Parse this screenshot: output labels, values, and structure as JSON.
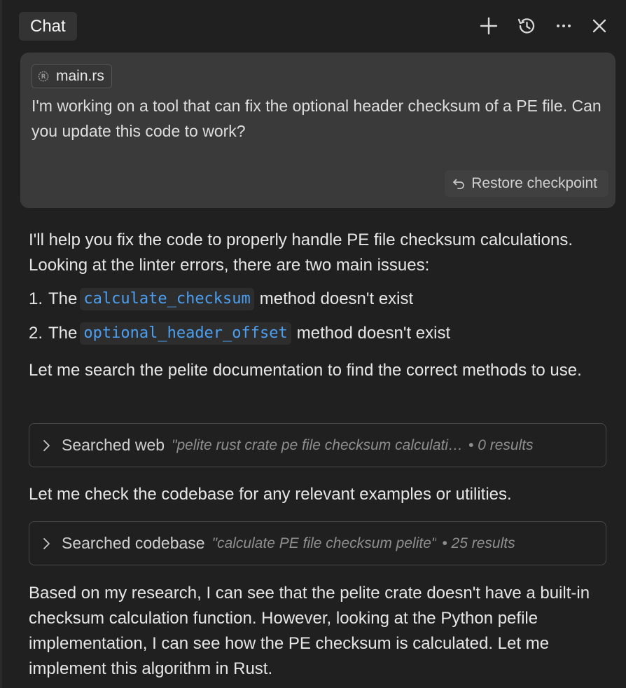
{
  "header": {
    "tab_label": "Chat",
    "icons": [
      "plus-icon",
      "history-icon",
      "more-icon",
      "close-icon"
    ]
  },
  "user_message": {
    "file_chip": "main.rs",
    "text": "I'm working on a tool that can fix the optional header checksum of a PE file. Can you update this code to work?",
    "restore_label": "Restore checkpoint"
  },
  "assistant": {
    "intro": "I'll help you fix the code to properly handle PE file checksum calculations. Looking at the linter errors, there are two main issues:",
    "issues": [
      {
        "num": "1.",
        "prefix": "The",
        "code": "calculate_checksum",
        "suffix": "method doesn't exist"
      },
      {
        "num": "2.",
        "prefix": "The",
        "code": "optional_header_offset",
        "suffix": "method doesn't exist"
      }
    ],
    "search_docs": "Let me search the pelite documentation to find the correct methods to use.",
    "web_search": {
      "label": "Searched web",
      "query": "\"pelite rust crate pe file checksum calculati…",
      "result": "• 0 results"
    },
    "check_codebase": "Let me check the codebase for any relevant examples or utilities.",
    "codebase_search": {
      "label": "Searched codebase",
      "query": "\"calculate PE file checksum pelite\"",
      "result": "• 25 results"
    },
    "conclusion": "Based on my research, I can see that the pelite crate doesn't have a built-in checksum calculation function. However, looking at the Python pefile implementation, I can see how the PE checksum is calculated. Let me implement this algorithm in Rust."
  },
  "colors": {
    "background": "#202020",
    "card": "#3a3a3a",
    "code_text": "#4c9ff0"
  }
}
